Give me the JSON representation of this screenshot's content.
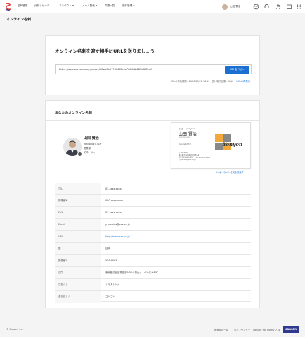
{
  "nav": {
    "items": [
      "名刺管理",
      "分析リサーチ",
      "コンタクト ▾",
      "メール配信 ▾",
      "同期一覧",
      "案件管理 ▾"
    ],
    "user_name": "山田 賢治 ▾",
    "icons": [
      "chat-icon",
      "bell-icon",
      "people-icon",
      "calendar-icon",
      "grid-icon"
    ],
    "accent": "#1a6fd1"
  },
  "page_title": "オンライン名刺",
  "share": {
    "heading": "オンライン名刺を渡す相手にURLを送りましょう",
    "url": "https://ap.sansan.com/v/xxxxx/59eb9b2715bf48c5d05b9d6665b9f81ef",
    "copy_label": "URLをコピー",
    "meta": "URLの有効期限：2020/03/22 14:15　受け取り回数：0/10",
    "meta_link": "URLの再発行"
  },
  "card_section": {
    "heading": "あなたのオンライン名刺",
    "name": "山田 賢治",
    "company": "Yonyon株式会社",
    "department": "営業部",
    "title": "マネージャー",
    "bizcard": {
      "dept": "営業部　マネージャー",
      "name": "山田 賢治",
      "romaji": "Kenji Yamada",
      "company": "Yonyon株式会社",
      "brand": "Yonyon",
      "lines": [
        "〒150-0001",
        "東京都渋谷区神宮前5-52-2",
        "TEL 03-xxxx-xxxx　FAX 03-xxxx-xxxx",
        "y-yoshida@xxx.co.jp"
      ]
    },
    "flip_label": "↻ オンライン名刺を裏返す",
    "rows": [
      {
        "k": "TEL",
        "v": "03-xxxx-xxxx"
      },
      {
        "k": "携帯番号",
        "v": "090-xxxx-xxxx"
      },
      {
        "k": "FAX",
        "v": "03-xxxx-xxxx"
      },
      {
        "k": "Email",
        "v": "y-yoshida@xxx.co.jp"
      },
      {
        "k": "URL",
        "v": "http://www.xxx.co.jp"
      },
      {
        "k": "国",
        "v": "日本"
      },
      {
        "k": "郵便番号",
        "v": "150-0001"
      },
      {
        "k": "住所",
        "v": "東京都渋谷区神宮前5-52-2青山オーバルビル13F"
      },
      {
        "k": "氏名カナ",
        "v": "ヤマダケンジ"
      },
      {
        "k": "会社名カナ",
        "v": "ヨンヨン"
      }
    ]
  },
  "footer": {
    "copyright": "© Sansan, Inc.",
    "links": [
      "推奨環境一覧",
      "ヘルプセンター",
      "Sansan 'for Teams' とは"
    ],
    "brand": "sansan"
  }
}
